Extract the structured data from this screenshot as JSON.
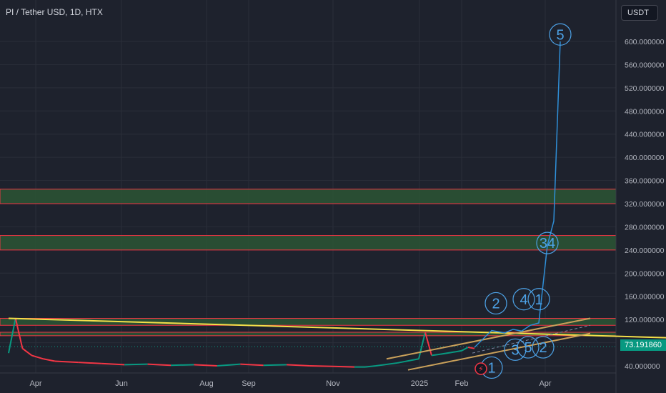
{
  "header": {
    "symbol_title": "PI / Tether USD, 1D, HTX",
    "currency": "USDT"
  },
  "price_tag": {
    "value": "73.191860",
    "color": "#089981"
  },
  "colors": {
    "background": "#1e222d",
    "grid": "#2a2e39",
    "axis_text": "#b2b5be",
    "zone_fill": "#2e5c36",
    "zone_border": "#f23645",
    "wave_line": "#2f8fd8",
    "wave_label": "#4da3e8",
    "trend_line": "#f5e04a",
    "channel_line": "#c9a05a",
    "candle_up": "#089981",
    "candle_down": "#f23645"
  },
  "chart_data": {
    "type": "line",
    "title": "PI / Tether USD, 1D, HTX",
    "x_labels": [
      "Apr",
      "Jun",
      "Aug",
      "Sep",
      "Nov",
      "2025",
      "Feb",
      "Apr"
    ],
    "y_ticks": [
      "40.000000",
      "80.000000",
      "120.000000",
      "160.000000",
      "200.000000",
      "240.000000",
      "280.000000",
      "320.000000",
      "360.000000",
      "400.000000",
      "440.000000",
      "480.000000",
      "520.000000",
      "560.000000",
      "600.000000"
    ],
    "ylim": [
      30,
      620
    ],
    "last_price": 73.19186,
    "zones": [
      {
        "low": 320,
        "high": 345
      },
      {
        "low": 240,
        "high": 265
      },
      {
        "low": 110,
        "high": 122
      },
      {
        "low": 92,
        "high": 98
      }
    ],
    "price_series": [
      {
        "x": 0.0,
        "y": 62
      },
      {
        "x": 0.3,
        "y": 122
      },
      {
        "x": 0.6,
        "y": 70
      },
      {
        "x": 1.0,
        "y": 58
      },
      {
        "x": 1.5,
        "y": 52
      },
      {
        "x": 2.0,
        "y": 48
      },
      {
        "x": 3.0,
        "y": 46
      },
      {
        "x": 4.0,
        "y": 44
      },
      {
        "x": 5.0,
        "y": 42
      },
      {
        "x": 6.0,
        "y": 43
      },
      {
        "x": 7.0,
        "y": 41
      },
      {
        "x": 8.0,
        "y": 42
      },
      {
        "x": 9.0,
        "y": 40
      },
      {
        "x": 10.0,
        "y": 43
      },
      {
        "x": 11.0,
        "y": 41
      },
      {
        "x": 12.0,
        "y": 42
      },
      {
        "x": 13.0,
        "y": 40
      },
      {
        "x": 14.0,
        "y": 39
      },
      {
        "x": 15.0,
        "y": 38
      },
      {
        "x": 15.5,
        "y": 38
      },
      {
        "x": 16.0,
        "y": 40
      },
      {
        "x": 17.0,
        "y": 45
      },
      {
        "x": 18.0,
        "y": 52
      },
      {
        "x": 18.3,
        "y": 98
      },
      {
        "x": 18.6,
        "y": 58
      },
      {
        "x": 19.0,
        "y": 60
      },
      {
        "x": 19.5,
        "y": 63
      },
      {
        "x": 20.0,
        "y": 66
      },
      {
        "x": 20.3,
        "y": 72
      },
      {
        "x": 20.6,
        "y": 70
      }
    ],
    "wave_projection": [
      {
        "x": 20.6,
        "y": 72
      },
      {
        "x": 21.4,
        "y": 101
      },
      {
        "x": 22.0,
        "y": 97
      },
      {
        "x": 22.4,
        "y": 103
      },
      {
        "x": 22.8,
        "y": 100
      },
      {
        "x": 23.2,
        "y": 110
      },
      {
        "x": 23.6,
        "y": 114
      },
      {
        "x": 24.0,
        "y": 248
      },
      {
        "x": 24.3,
        "y": 290
      },
      {
        "x": 24.6,
        "y": 600
      }
    ],
    "trend_line": [
      {
        "x": 0.0,
        "y": 122
      },
      {
        "x": 31.0,
        "y": 87
      }
    ],
    "channel_upper": [
      {
        "x": 16.5,
        "y": 52
      },
      {
        "x": 26.0,
        "y": 122
      }
    ],
    "channel_lower": [
      {
        "x": 17.5,
        "y": 33
      },
      {
        "x": 26.0,
        "y": 96
      }
    ],
    "channel_mid": [
      {
        "x": 20.5,
        "y": 62
      },
      {
        "x": 26.0,
        "y": 110
      }
    ],
    "wave_labels": [
      {
        "text": "5",
        "x": 24.6,
        "y": 612
      },
      {
        "text": "34",
        "x": 24.0,
        "y": 252
      },
      {
        "text": "2",
        "x": 21.6,
        "y": 148
      },
      {
        "text": "4",
        "x": 22.9,
        "y": 155
      },
      {
        "text": "1",
        "x": 23.6,
        "y": 155
      },
      {
        "text": "3",
        "x": 22.5,
        "y": 68
      },
      {
        "text": "5",
        "x": 23.1,
        "y": 72
      },
      {
        "text": "2",
        "x": 23.8,
        "y": 72
      },
      {
        "text": "1",
        "x": 21.4,
        "y": 37
      }
    ]
  }
}
